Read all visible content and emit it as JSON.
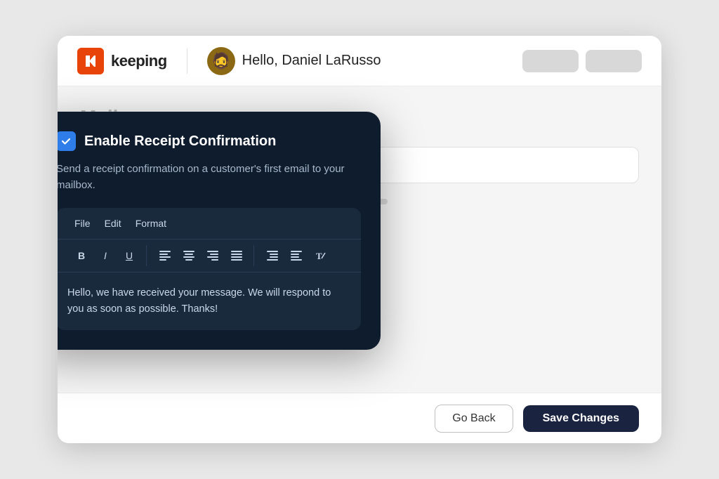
{
  "app": {
    "logo_text": "keeping",
    "user": {
      "greeting": "Hello, Daniel LaRusso",
      "avatar_emoji": "🧔"
    },
    "footer": {
      "go_back_label": "Go Back",
      "save_changes_label": "Save Changes"
    },
    "body": {
      "mail_title": "Mail"
    }
  },
  "modal": {
    "title": "Enable Receipt Confirmation",
    "description": "Send a receipt confirmation on a customer's first email to your mailbox.",
    "checkbox_checked": true,
    "editor": {
      "menu": {
        "file": "File",
        "edit": "Edit",
        "format": "Format"
      },
      "toolbar": {
        "bold": "B",
        "italic": "I",
        "underline": "U",
        "align_left": "≡",
        "align_center": "≡",
        "align_right": "≡",
        "justify": "≡",
        "indent": "≡",
        "outdent": "≡",
        "clear_format": "T"
      },
      "content": "Hello, we have received your message. We will respond to you as soon as possible. Thanks!"
    }
  }
}
